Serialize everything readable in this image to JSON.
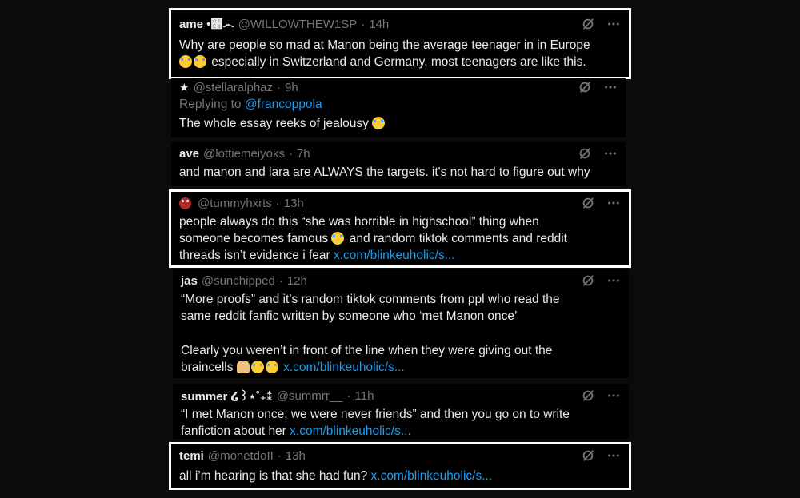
{
  "tweets": [
    {
      "name": "ame •௡෴",
      "handle": "@WILLOWTHEW1SP",
      "time": "14h",
      "line1": "Why are people so mad at Manon being the average teenager in in Europe",
      "line2_text": " especially in Switzerland and Germany, most teenagers are like this."
    },
    {
      "handle": "@stellaralphaz",
      "time": "9h",
      "replying_prefix": "Replying to ",
      "replying_to": "@francoppola",
      "text": "The whole essay reeks of jealousy "
    },
    {
      "name": "ave",
      "handle": "@lottiemeiyoks",
      "time": "7h",
      "text": "and manon and lara are ALWAYS the targets. it's not hard to figure out why"
    },
    {
      "handle": "@tummyhxrts",
      "time": "13h",
      "line1": "people always do this “she was horrible in highschool” thing when",
      "line2a": "someone becomes famous ",
      "line2b": " and random tiktok comments and reddit",
      "line3": "threads isn’t evidence i fear ",
      "link": "x.com/blinkeuholic/s..."
    },
    {
      "name": "jas",
      "handle": "@sunchipped",
      "time": "12h",
      "line1": "“More proofs” and it’s random tiktok comments from ppl who read the",
      "line2": "same reddit fanfic written by someone who ‘met Manon once’",
      "line3": "Clearly you weren’t in front of the line when they were giving out the",
      "line4": "braincells ",
      "link": "x.com/blinkeuholic/s..."
    },
    {
      "name": "summer ໒꒱⋆˚₊⁑",
      "handle": "@summrr__",
      "time": "11h",
      "line1": "“I met Manon once, we were never friends” and then you go on to write",
      "line2": "fanfiction about her  ",
      "link": "x.com/blinkeuholic/s..."
    },
    {
      "name": "temi",
      "handle": "@monetdoII",
      "time": "13h",
      "text": "all i’m hearing is that she had fun? ",
      "link": "x.com/blinkeuholic/s..."
    }
  ],
  "separator": "·",
  "icons": {
    "grok": "grok-icon",
    "more": "more-options-icon",
    "crying": "loudly-crying-face-emoji",
    "pray": "folded-hands-emoji",
    "avatar_emoji": "ogre-emoji",
    "star": "star-icon"
  },
  "colors": {
    "link": "#1d9bf0",
    "muted": "#71767b",
    "text": "#e7e9ea",
    "highlight_border": "#ffffff"
  }
}
